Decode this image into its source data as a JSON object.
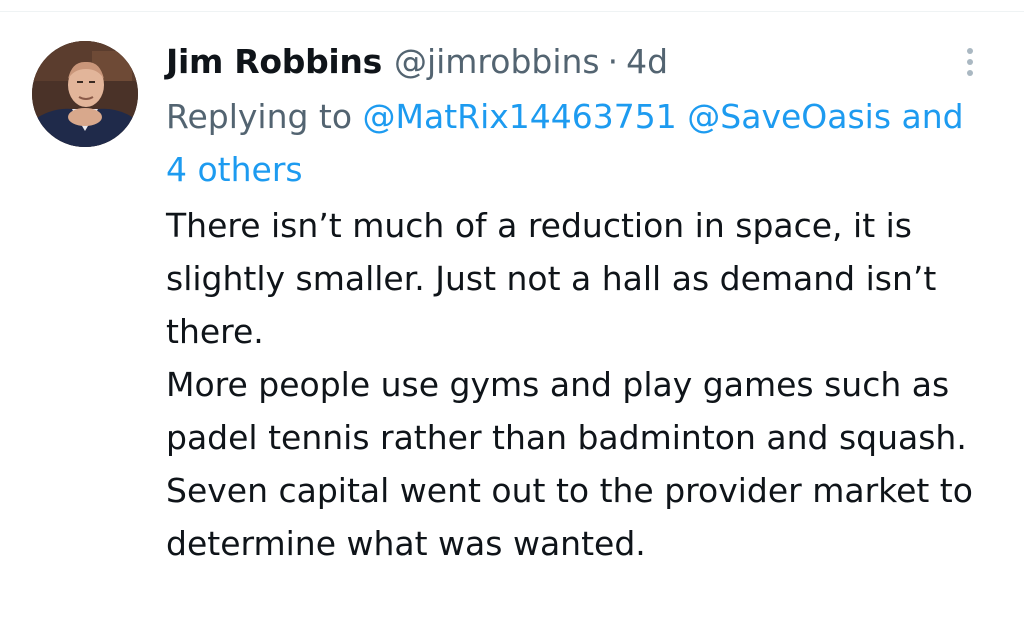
{
  "tweet": {
    "author": {
      "display_name": "Jim Robbins",
      "handle": "@jimrobbins",
      "avatar_icon": "profile-photo"
    },
    "separator": "·",
    "timestamp": "4d",
    "more_icon": "more-vertical-icon",
    "reply": {
      "prefix": "Replying to",
      "mention_1": "@MatRix14463751",
      "mention_2": "@SaveOasis",
      "others": "and 4 others"
    },
    "paragraphs": [
      "There isn’t much of a reduction in space, it is slightly smaller. Just not a hall as demand isn’t there.",
      "More people use gyms and play games such as padel tennis rather than badminton and squash.",
      "Seven capital went out to the provider market to determine what was wanted."
    ]
  },
  "colors": {
    "text_primary": "#0f1419",
    "text_secondary": "#536471",
    "link": "#1d9bf0",
    "background": "#ffffff"
  }
}
